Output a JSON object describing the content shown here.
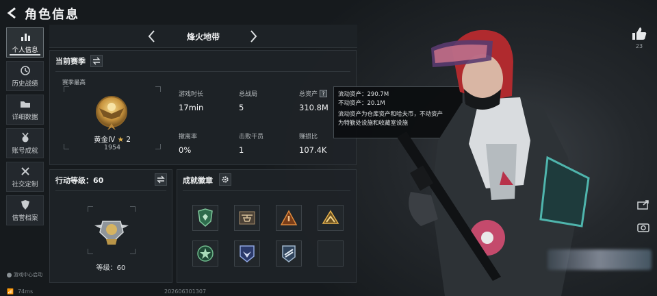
{
  "header": {
    "title": "角色信息"
  },
  "sidebar": {
    "items": [
      {
        "label": "个人信息",
        "icon": "bar-chart-icon",
        "active": true
      },
      {
        "label": "历史战绩",
        "icon": "clock-icon"
      },
      {
        "label": "详细数据",
        "icon": "folder-icon"
      },
      {
        "label": "账号成就",
        "icon": "medal-icon"
      },
      {
        "label": "社交定制",
        "icon": "tools-icon"
      },
      {
        "label": "信誉档案",
        "icon": "shield-icon"
      }
    ],
    "footer_note": "游戏中心启动",
    "ping": "74ms"
  },
  "footer": {
    "id": "202606301307"
  },
  "mode": {
    "title": "烽火地带"
  },
  "season": {
    "heading": "当前赛季",
    "subtitle": "赛季最高",
    "rank_name": "黄金IV",
    "rank_star": "★",
    "rank_stars": "2",
    "rank_score": "1954",
    "stats": [
      {
        "label": "游戏时长",
        "value": "17min"
      },
      {
        "label": "总战局",
        "value": "5"
      },
      {
        "label": "总资产",
        "value": "310.8M"
      },
      {
        "label": "撤离率",
        "value": "0%"
      },
      {
        "label": "击败干员",
        "value": "1"
      },
      {
        "label": "赚损比",
        "value": "107.4K"
      }
    ]
  },
  "tooltip": {
    "line1": "流动资产：290.7M",
    "line2": "不动资产：20.1M",
    "line3": "流动资产为仓库资产和哈夫币，不动资产",
    "line4": "为特勤处设施和收藏室设施"
  },
  "operation": {
    "heading": "行动等级：60",
    "level_text": "等级：60"
  },
  "achievements": {
    "heading": "成就徽章",
    "badges": [
      "green-shield-badge",
      "helicopter-badge",
      "orange-rank-badge",
      "yellow-chevron-badge",
      "green-star-badge",
      "blue-eagle-badge",
      "blue-wing-badge",
      "empty-slot"
    ]
  },
  "social": {
    "likes": "23"
  },
  "colors": {
    "accent_gold": "#e3b34c",
    "panel_bg": "#1e2327",
    "tooltip_bg": "#0c0e10"
  }
}
